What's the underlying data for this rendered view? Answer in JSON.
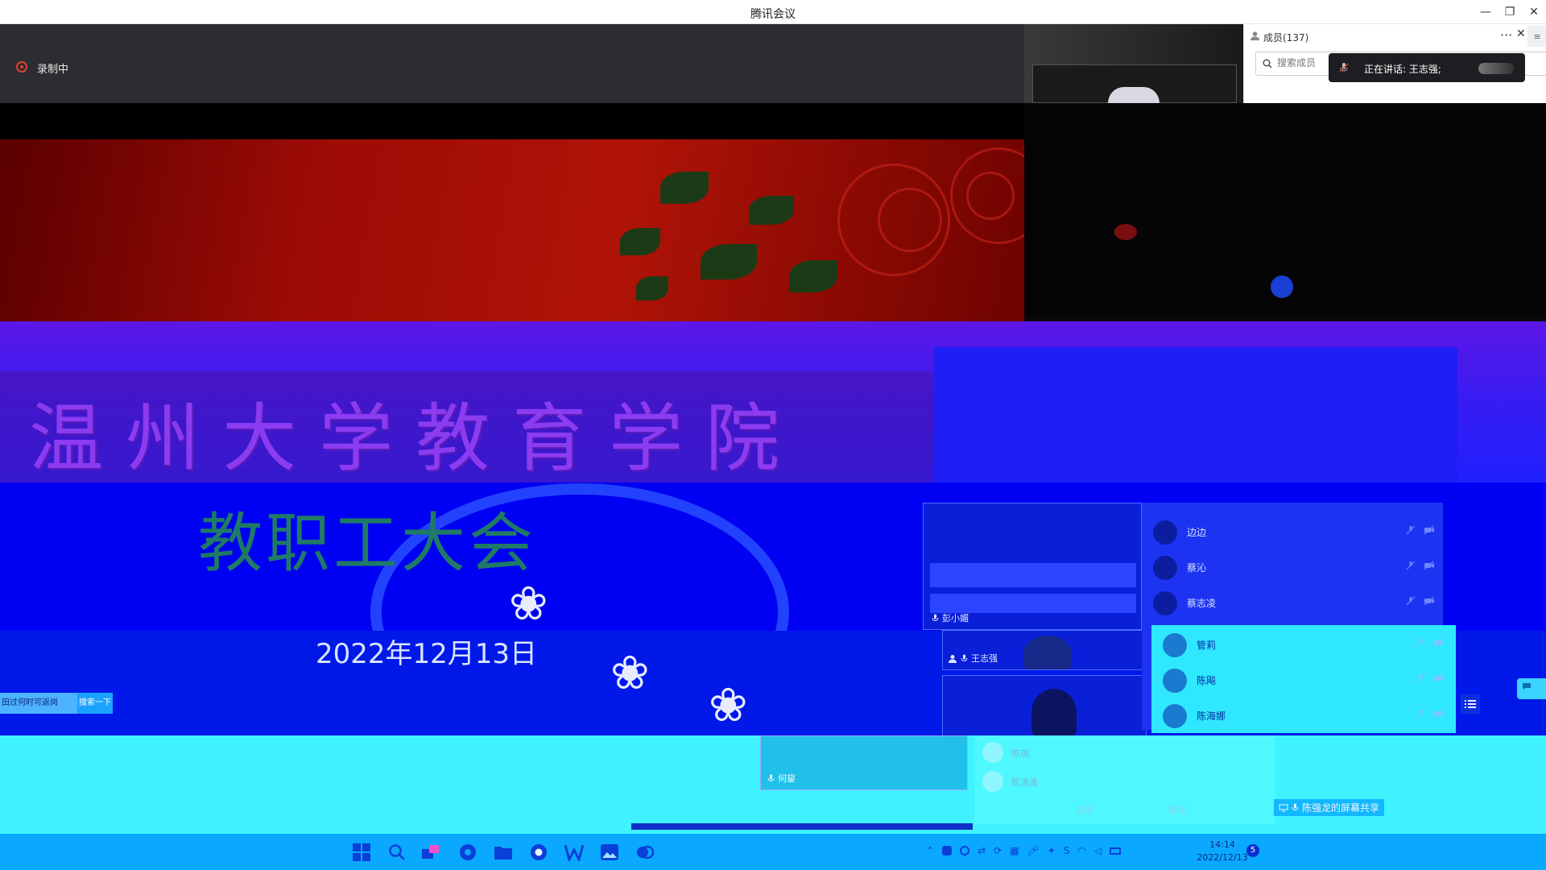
{
  "window": {
    "title": "腾讯会议",
    "controls": {
      "minimize": "—",
      "restore": "❐",
      "close": "✕"
    }
  },
  "recording": {
    "label": "录制中"
  },
  "members_panel": {
    "title": "成员(137)",
    "more": "···",
    "close": "✕",
    "search_placeholder": "搜索成员",
    "speaking_toast": "正在讲话: 王志强;"
  },
  "slide": {
    "title": "温州大学教育学院",
    "subtitle": "教职工大会",
    "date": "2022年12月13日"
  },
  "ad": {
    "text": "田过何时可返岗",
    "button": "搜索一下"
  },
  "video_tiles": [
    {
      "name": "彭小媚"
    },
    {
      "name": "王志强"
    },
    {
      "name": "何鋆"
    }
  ],
  "member_list": [
    {
      "name": "边边"
    },
    {
      "name": "蔡沁"
    },
    {
      "name": "蔡志凌"
    },
    {
      "name": "管莉"
    },
    {
      "name": "陈飚"
    },
    {
      "name": "陈海娜"
    }
  ],
  "member_list_lower": [
    {
      "name": "陈璃"
    },
    {
      "name": "陈潇潇"
    }
  ],
  "lower_actions": {
    "action_a": "邀请",
    "action_b": "静音"
  },
  "screen_share": {
    "label": "陈强龙的屏幕共享"
  },
  "taskbar": {
    "time": "14:14",
    "date": "2022/12/13",
    "notifications": "5"
  },
  "colors": {
    "accent_red": "#e0403a",
    "taskbar": "#0aa8ff",
    "panel_bg": "#ffffff"
  }
}
